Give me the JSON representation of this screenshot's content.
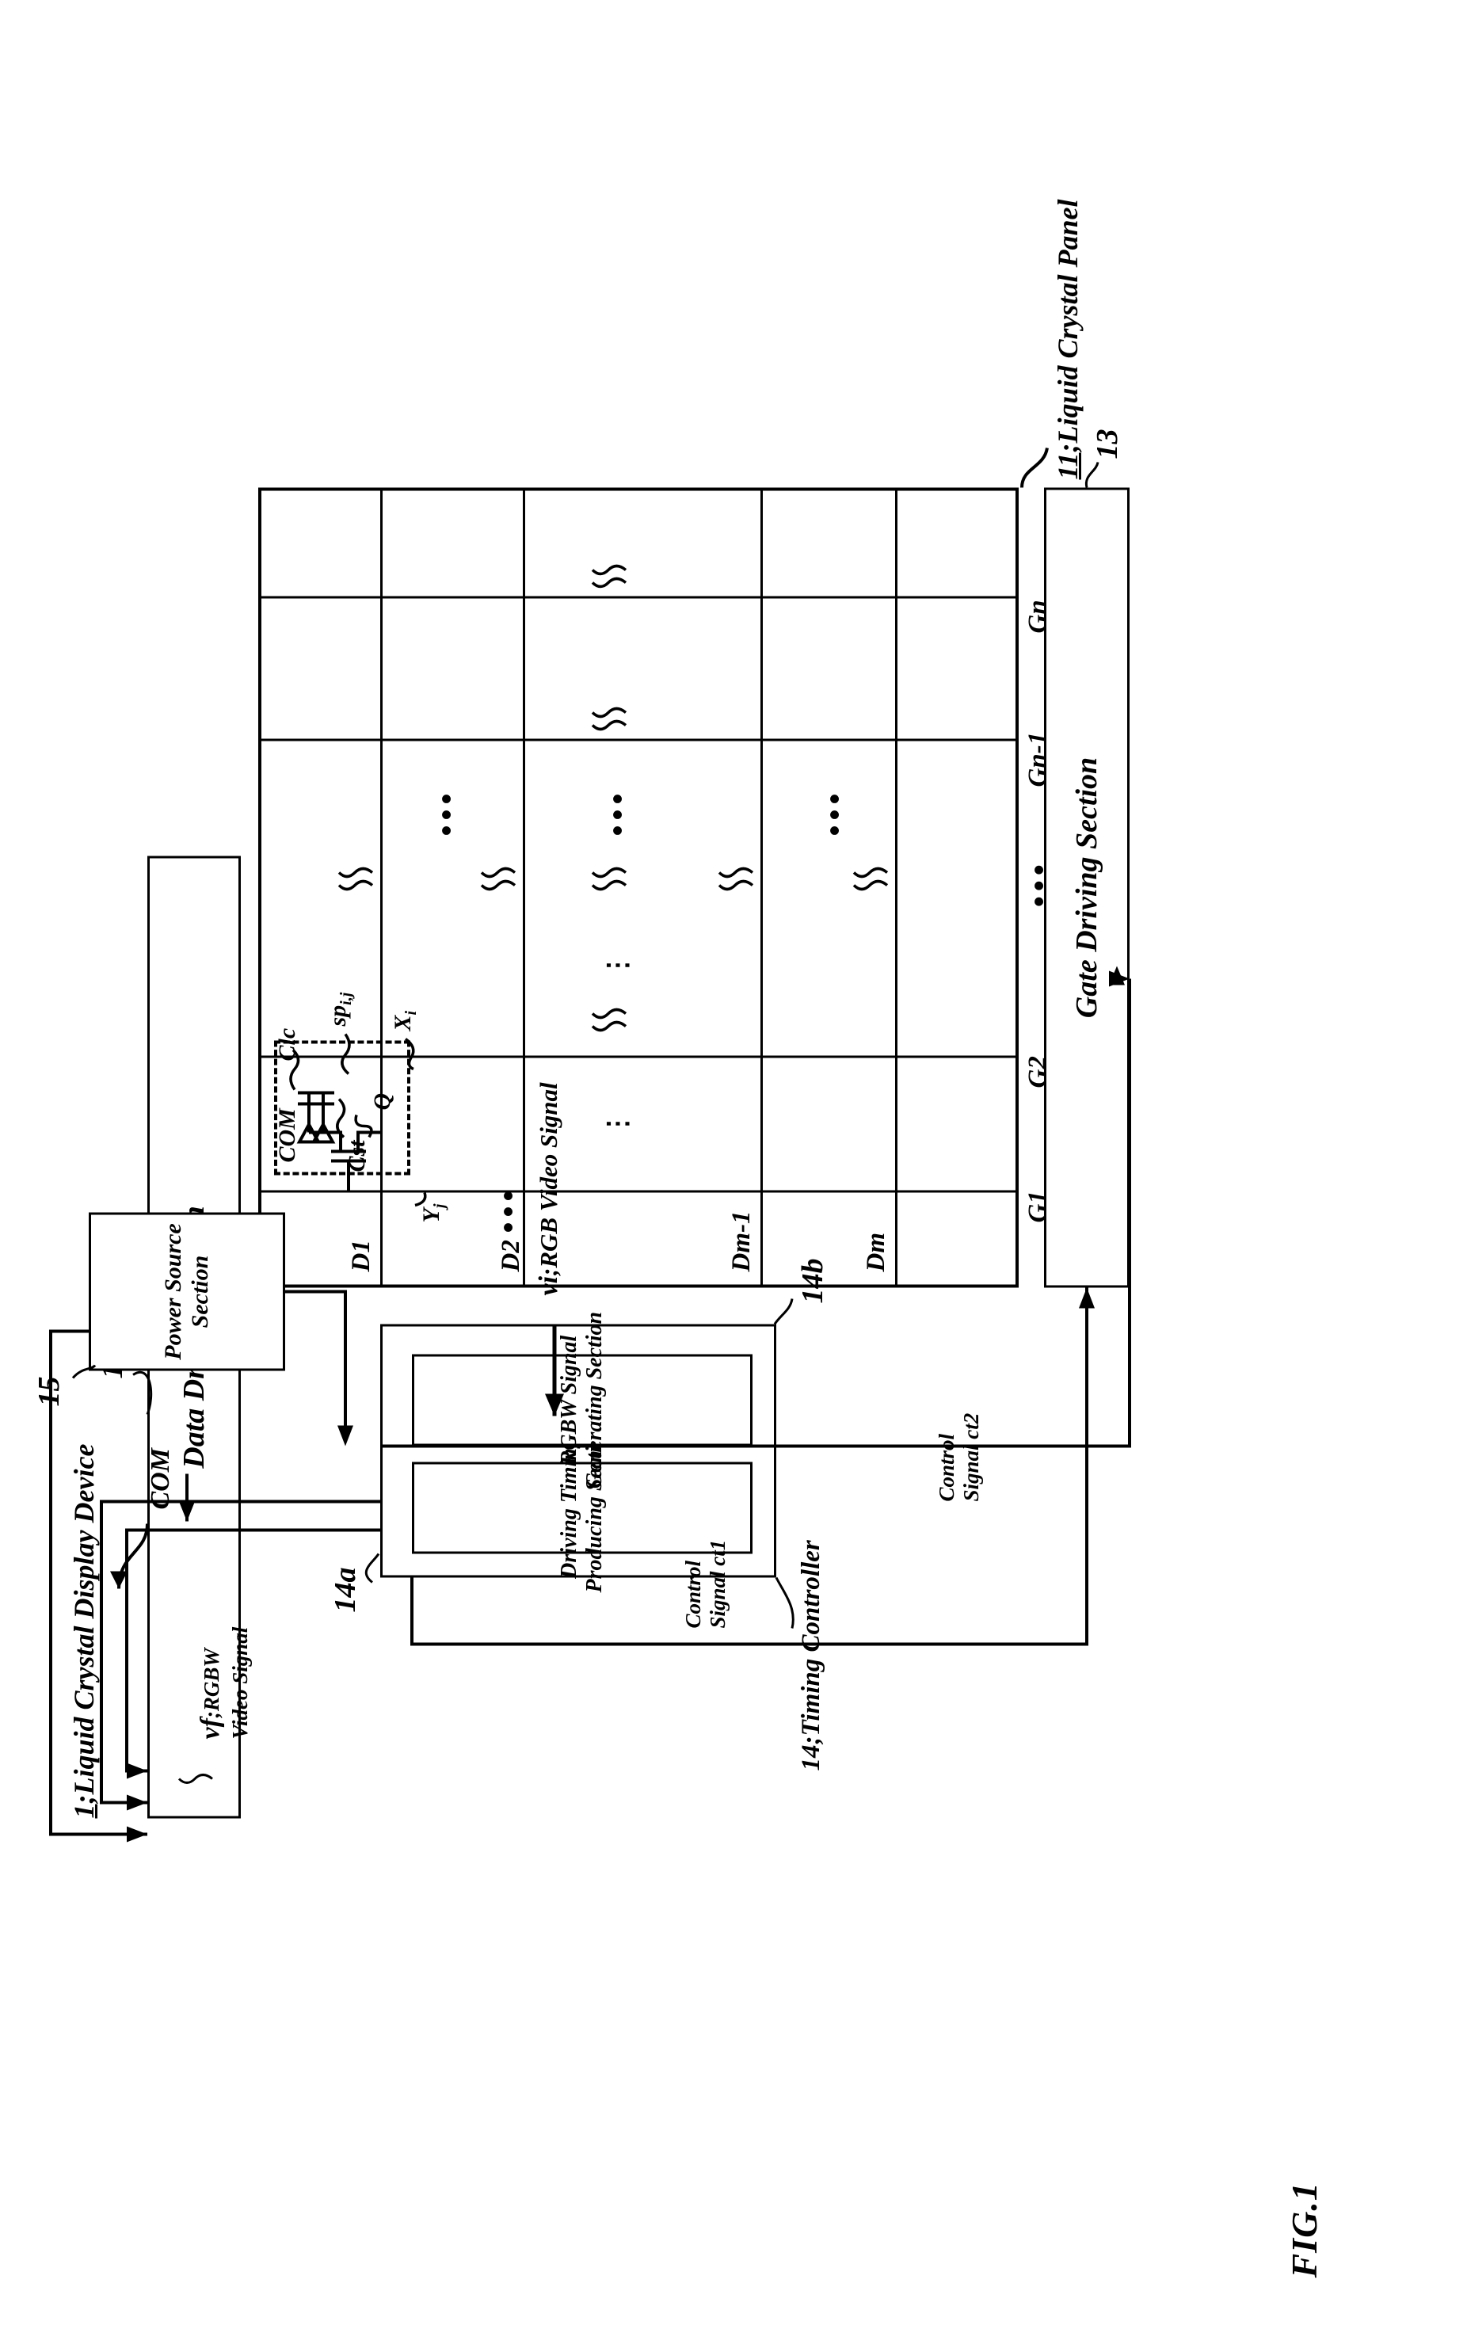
{
  "figure": {
    "title": "FIG.1",
    "device_label_num": "1",
    "device_label": ";Liquid Crystal Display Device",
    "panel_label_num": "11",
    "panel_label": ";Liquid Crystal Panel"
  },
  "blocks": {
    "data_driving": {
      "ref": "12",
      "label": "Data Driving Section"
    },
    "gate_driving": {
      "ref": "13",
      "label": "Gate Driving Section"
    },
    "timing_controller": {
      "ref": "14",
      "label": ";Timing Controller",
      "sub_a": {
        "ref": "14a",
        "line1": "Driving Timing",
        "line2": "Producing Section"
      },
      "sub_b": {
        "ref": "14b",
        "line1": "RGBW Signal",
        "line2": "Generating Section"
      }
    },
    "power_source": {
      "ref": "15",
      "line1": "Power Source",
      "line2": "Section"
    }
  },
  "signals": {
    "com": "COM",
    "video_out_name": "vf",
    "video_out_label": ";RGBW",
    "video_out_label2": "Video Signal",
    "video_in_name": "vi",
    "video_in_label": ";RGB Video Signal",
    "ctrl1_line1": "Control",
    "ctrl1_line2": "Signal ct1",
    "ctrl2_line1": "Control",
    "ctrl2_line2": "Signal ct2"
  },
  "panel": {
    "data_lines": [
      "D1",
      "D2",
      "Dm-1",
      "Dm"
    ],
    "data_line_dots": "•••",
    "gate_lines": [
      "G1",
      "G2",
      "Gn-1",
      "Gn"
    ],
    "gate_dots": "•••",
    "row_dots": "⋮",
    "col_dots": "•••"
  },
  "pixel_circuit": {
    "com": "COM",
    "cap_lc": "Clc",
    "cap_st": "Cst",
    "transistor": "Q",
    "subpixel": "sp",
    "subpixel_sub": "i,j",
    "data_node": "X",
    "data_node_sub": "i",
    "gate_node": "Y",
    "gate_node_sub": "j"
  }
}
